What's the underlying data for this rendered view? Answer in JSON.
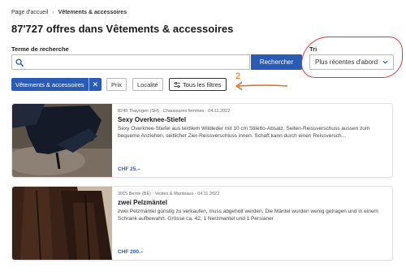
{
  "breadcrumb": {
    "home": "Page d'accueil",
    "separator": "›",
    "current": "Vêtements & accessoires"
  },
  "page_title": "87'727 offres dans Vêtements & accessoires",
  "search": {
    "label": "Terme de recherche",
    "value": "",
    "placeholder": "",
    "button": "Rechercher"
  },
  "sort": {
    "label": "Tri",
    "selected": "Plus récentes d'abord"
  },
  "filters": {
    "active_chip": "Vêtements & accessoires",
    "active_chip_remove": "✕",
    "chips": [
      "Prix",
      "Localité"
    ],
    "all_filters": "Tous les filtres"
  },
  "annotation": {
    "number": "2",
    "color": "#e06a1c",
    "circle_color": "#d63a3a"
  },
  "listings": [
    {
      "meta": "8240 Thayngen (SH) · Chaussures femmes · 04.11.2022",
      "title": "Sexy Overknee-Stiefel",
      "description": "Sexy Overknee-Stiefel aus textilem Wildleder mit 10 cm Stiletto-Absatz. Seiten-Reissverschuss aussen zum bequeme Anziehen, seitlicher Zier-Reissverschluss innen. Schaft kann durch einen Reissversch...",
      "price": "CHF 25.–"
    },
    {
      "meta": "3015 Berne (BE) · Vestes & Manteaux · 04.11.2022",
      "title": "zwei Pelzmäntel",
      "description": "zwei Pelzmäntel günstig zu verkaufen, muss abgeholt werden. Die Mäntel wurden wenig getragen und in einem Schrank aufbewahrt. Grösse ca. 42, 1 Nerzmantel und 1 Persianer",
      "price": "CHF 200.–"
    }
  ],
  "colors": {
    "accent": "#2a5bb5",
    "price": "#2a5bb5"
  },
  "icons": {
    "search": "search-icon",
    "sort_chevron": "chevron-down-icon",
    "filters": "sliders-icon",
    "remove": "close-icon"
  }
}
